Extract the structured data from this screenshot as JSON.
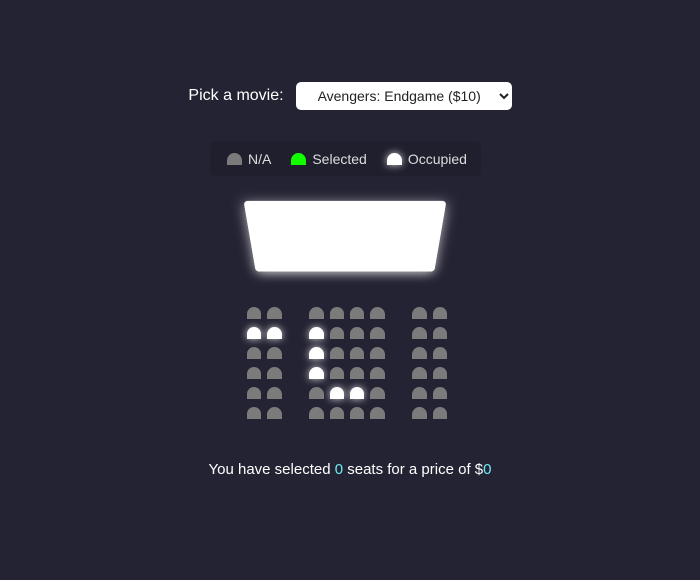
{
  "movie_picker": {
    "label": "Pick a movie:",
    "selected_option": "Avengers: Endgame ($10)"
  },
  "legend": {
    "na": "N/A",
    "selected": "Selected",
    "occupied": "Occupied"
  },
  "summary": {
    "prefix": "You have selected",
    "count": "0",
    "middle": "seats for a price of $",
    "price": "0"
  },
  "colors": {
    "background": "#242333",
    "seat_available": "#7b7b7b",
    "seat_selected": "#12ff00",
    "seat_occupied": "#ffffff",
    "accent": "#6feaf6"
  },
  "seat_rows": [
    [
      "available",
      "available",
      "available",
      "available",
      "available",
      "available",
      "available",
      "available"
    ],
    [
      "occupied",
      "occupied",
      "occupied",
      "available",
      "available",
      "available",
      "available",
      "available"
    ],
    [
      "available",
      "available",
      "occupied",
      "available",
      "available",
      "available",
      "available",
      "available"
    ],
    [
      "available",
      "available",
      "occupied",
      "available",
      "available",
      "available",
      "available",
      "available"
    ],
    [
      "available",
      "available",
      "available",
      "occupied",
      "occupied",
      "available",
      "available",
      "available"
    ],
    [
      "available",
      "available",
      "available",
      "available",
      "available",
      "available",
      "available",
      "available"
    ]
  ]
}
